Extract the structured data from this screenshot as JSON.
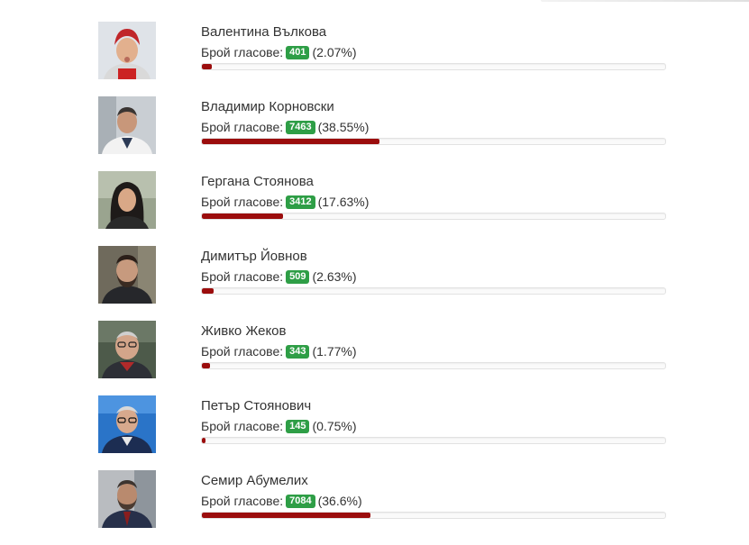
{
  "votes_label": "Брой гласове:",
  "colors": {
    "bar_fill": "#9b0d0d",
    "badge": "#2e9e46"
  },
  "candidates": [
    {
      "name": "Валентина Вълкова",
      "votes": "401",
      "percent": "(2.07%)",
      "share": 2.07,
      "photo": "portrait-woman-red-headscarf"
    },
    {
      "name": "Владимир Корновски",
      "votes": "7463",
      "percent": "(38.55%)",
      "share": 38.55,
      "photo": "portrait-man-white-coat"
    },
    {
      "name": "Гергана Стоянова",
      "votes": "3412",
      "percent": "(17.63%)",
      "share": 17.63,
      "photo": "portrait-woman-dark-hair"
    },
    {
      "name": "Димитър Йовнов",
      "votes": "509",
      "percent": "(2.63%)",
      "share": 2.63,
      "photo": "portrait-man-beard"
    },
    {
      "name": "Живко Жеков",
      "votes": "343",
      "percent": "(1.77%)",
      "share": 1.77,
      "photo": "portrait-man-glasses"
    },
    {
      "name": "Петър Стоянович",
      "votes": "145",
      "percent": "(0.75%)",
      "share": 0.75,
      "photo": "portrait-man-blue-background"
    },
    {
      "name": "Семир Абумелих",
      "votes": "7084",
      "percent": "(36.6%)",
      "share": 36.6,
      "photo": "portrait-man-suit"
    }
  ]
}
